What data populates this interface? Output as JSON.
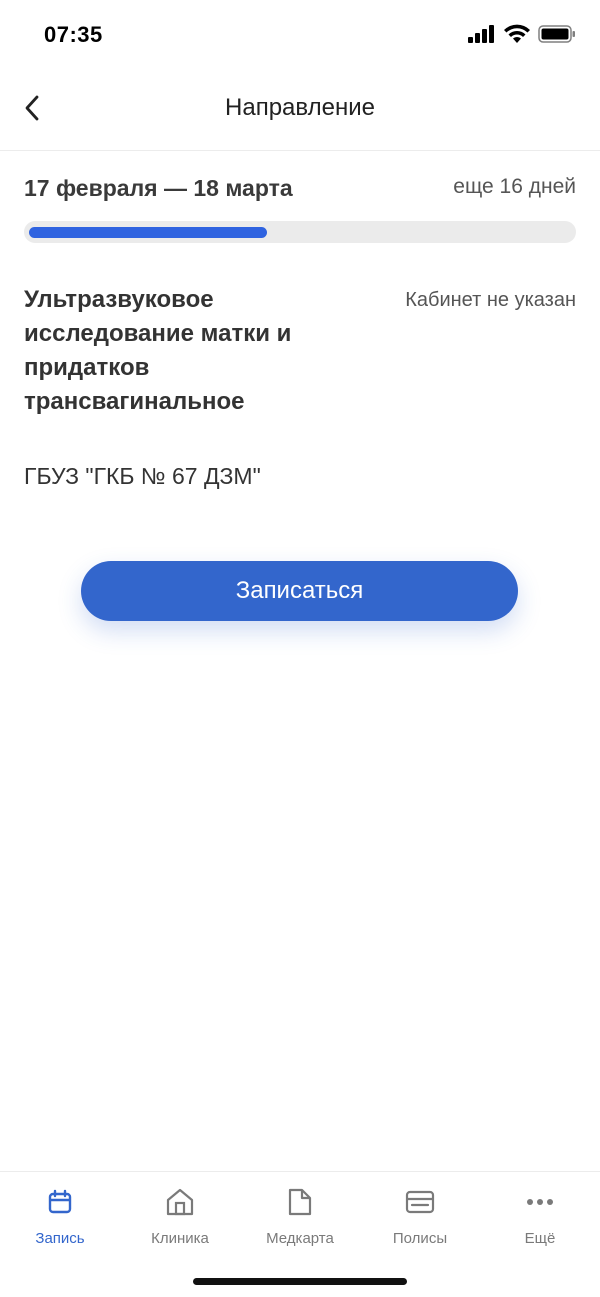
{
  "status_bar": {
    "time": "07:35"
  },
  "header": {
    "title": "Направление"
  },
  "referral": {
    "period": "17 февраля — 18 марта",
    "remaining": "еще 16 дней",
    "progress_percent": 44,
    "service": "Ультразвуковое исследование матки и придатков трансвагинальное",
    "room": "Кабинет не указан",
    "clinic": "ГБУЗ \"ГКБ № 67 ДЗМ\"",
    "book_label": "Записаться"
  },
  "nav": {
    "items": [
      {
        "label": "Запись",
        "icon": "calendar-icon",
        "active": true
      },
      {
        "label": "Клиника",
        "icon": "clinic-icon",
        "active": false
      },
      {
        "label": "Медкарта",
        "icon": "document-icon",
        "active": false
      },
      {
        "label": "Полисы",
        "icon": "card-icon",
        "active": false
      },
      {
        "label": "Ещё",
        "icon": "more-icon",
        "active": false
      }
    ]
  },
  "colors": {
    "accent": "#3366cc",
    "progress": "#2f63e0",
    "inactive": "#7a7a7a"
  }
}
